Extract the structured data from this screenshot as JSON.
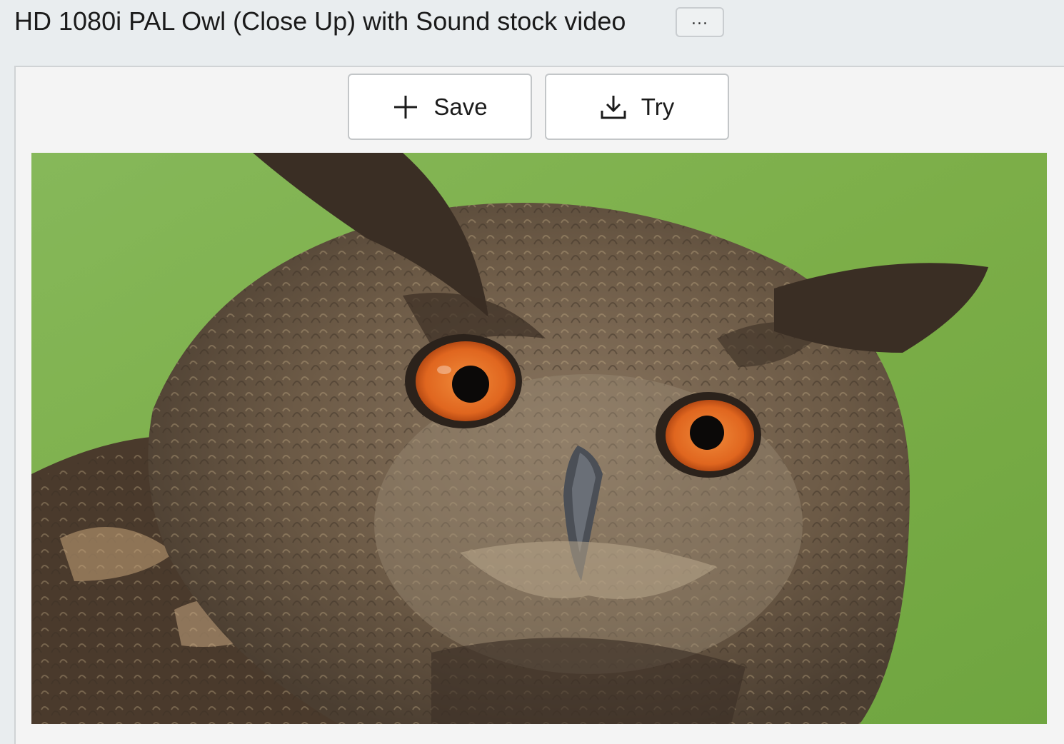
{
  "header": {
    "title": "HD 1080i PAL Owl (Close Up) with Sound stock video",
    "more_label": "..."
  },
  "actions": {
    "save_label": "Save",
    "save_icon": "plus-icon",
    "try_label": "Try",
    "try_icon": "download-icon"
  },
  "preview": {
    "subject": "close-up-owl-photo",
    "colors": {
      "background": "#7fb04a",
      "plumage": "#6e5c48",
      "eye": "#e0661f"
    }
  }
}
